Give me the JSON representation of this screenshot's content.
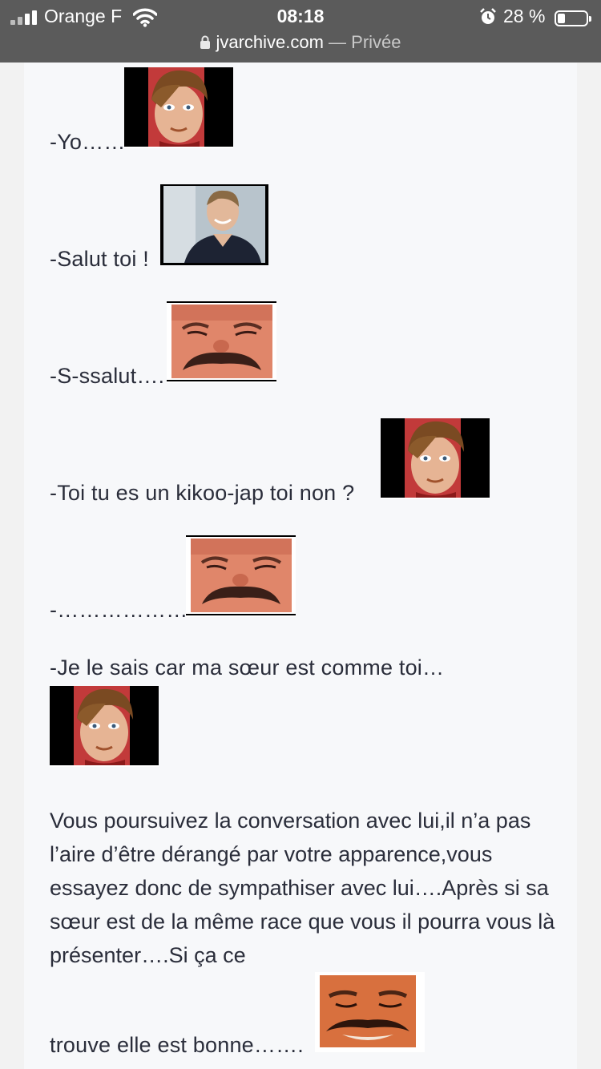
{
  "status_bar": {
    "carrier": "Orange F",
    "time": "08:18",
    "battery_percent": "28 %",
    "battery_level": 0.28,
    "url_host": "jvarchive.com",
    "url_suffix": " — Privée"
  },
  "dialogue": {
    "line1": "-Yo……",
    "line2": "-Salut toi !",
    "line3": "-S-ssalut….",
    "line4": "-Toi tu es un kikoo-jap toi non ?",
    "line5": "-………………..",
    "line6": "-Je le sais car ma sœur est comme toi…",
    "paragraph": "Vous poursuivez la conversation avec lui,il n’a pas l’aire d’être dérangé par votre apparence,vous essayez donc de sympathiser avec lui….Après si sa sœur est de la même race que vous il pourra vous là présenter….Si ça ce",
    "last_line": "trouve elle est bonne……."
  },
  "stickers": {
    "boy": "kikoo-boy-sticker",
    "man": "smiling-man-sticker",
    "risitas": "risitas-sticker"
  },
  "colors": {
    "status_bg": "#5b5b5b",
    "page_bg": "#f7f8fa",
    "text": "#2a2d3a"
  }
}
